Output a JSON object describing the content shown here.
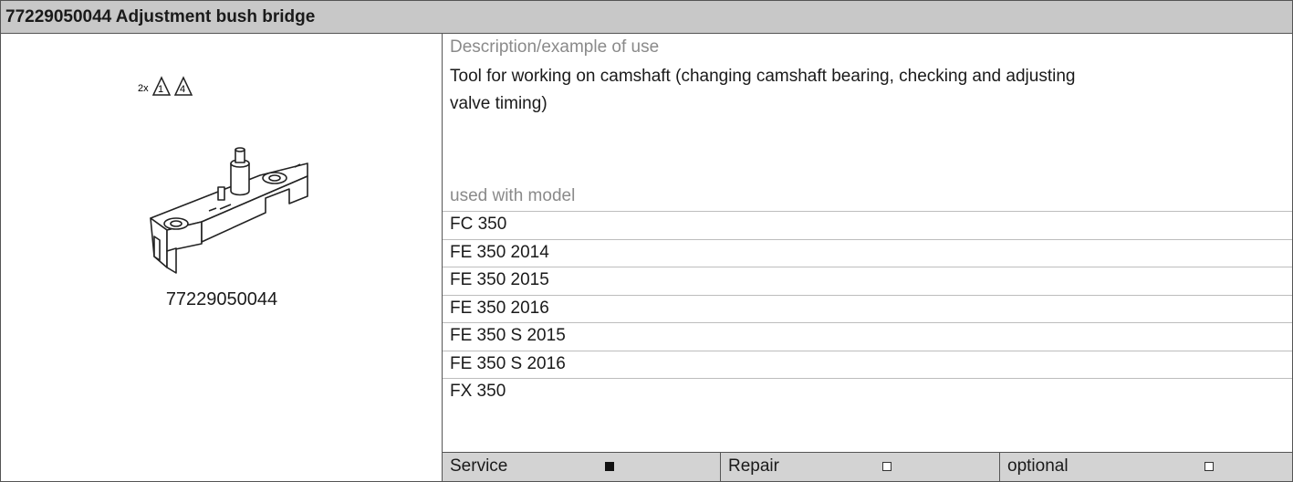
{
  "header": {
    "title": "77229050044 Adjustment bush bridge"
  },
  "figure": {
    "icon_note": "2x",
    "warning_symbols": [
      "1",
      "4"
    ],
    "part_number": "77229050044"
  },
  "description": {
    "label": "Description/example of use",
    "text_line1": "Tool for working on camshaft (changing camshaft bearing, checking and adjusting",
    "text_line2": "valve timing)"
  },
  "models": {
    "label": "used with model",
    "items": [
      "FC 350",
      "FE 350 2014",
      "FE 350 2015",
      "FE 350 2016",
      "FE 350 S 2015",
      "FE 350 S 2016",
      "FX 350"
    ]
  },
  "footer": {
    "service_label": "Service",
    "service_checked": true,
    "repair_label": "Repair",
    "repair_checked": false,
    "optional_label": "optional",
    "optional_checked": false
  }
}
